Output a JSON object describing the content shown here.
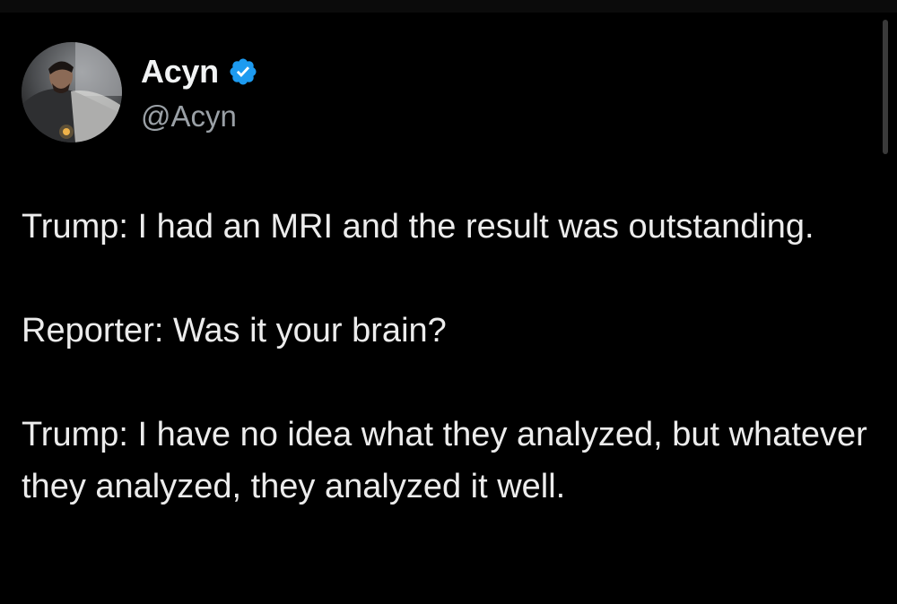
{
  "author": {
    "display_name": "Acyn",
    "handle": "@Acyn",
    "verified_icon": "verified-badge-icon",
    "verified_color": "#1d9bf0"
  },
  "tweet": {
    "paragraphs": [
      "Trump: I had an MRI and the result was outstanding.",
      "Reporter: Was it your brain?",
      "Trump: I have no idea what they analyzed, but whatever they analyzed, they analyzed it well."
    ]
  },
  "colors": {
    "background": "#000000",
    "text": "#e7e9ea",
    "secondary_text": "#9aa0a6"
  }
}
